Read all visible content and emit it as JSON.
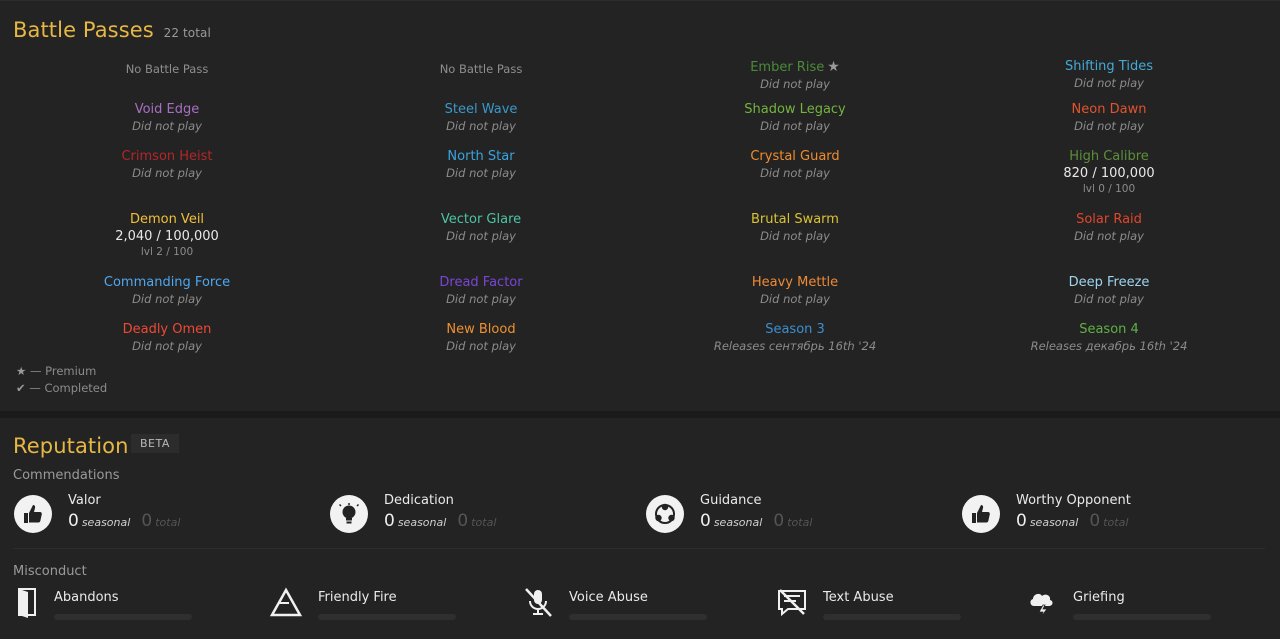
{
  "battle_passes": {
    "title": "Battle Passes",
    "count": "22 total",
    "items": [
      {
        "name": "No Battle Pass",
        "status": "",
        "color": "#8e8e8e",
        "none": true
      },
      {
        "name": "No Battle Pass",
        "status": "",
        "color": "#8e8e8e",
        "none": true
      },
      {
        "name": "Ember Rise",
        "status": "Did not play",
        "color": "#4c8a3a",
        "premium": true
      },
      {
        "name": "Shifting Tides",
        "status": "Did not play",
        "color": "#45a9d6"
      },
      {
        "name": "Void Edge",
        "status": "Did not play",
        "color": "#a86fc4"
      },
      {
        "name": "Steel Wave",
        "status": "Did not play",
        "color": "#3b98c9"
      },
      {
        "name": "Shadow Legacy",
        "status": "Did not play",
        "color": "#74b43d"
      },
      {
        "name": "Neon Dawn",
        "status": "Did not play",
        "color": "#e2532f"
      },
      {
        "name": "Crimson Heist",
        "status": "Did not play",
        "color": "#b3262a"
      },
      {
        "name": "North Star",
        "status": "Did not play",
        "color": "#3aa3e0"
      },
      {
        "name": "Crystal Guard",
        "status": "Did not play",
        "color": "#f08c2e"
      },
      {
        "name": "High Calibre",
        "status": "",
        "color": "#5d8f3a",
        "xp": "820 / 100,000",
        "level": "lvl 0 / 100"
      },
      {
        "name": "Demon Veil",
        "status": "",
        "color": "#f0c038",
        "xp": "2,040 / 100,000",
        "level": "lvl 2 / 100"
      },
      {
        "name": "Vector Glare",
        "status": "Did not play",
        "color": "#4cc4a4"
      },
      {
        "name": "Brutal Swarm",
        "status": "Did not play",
        "color": "#d9c234"
      },
      {
        "name": "Solar Raid",
        "status": "Did not play",
        "color": "#e0462c"
      },
      {
        "name": "Commanding Force",
        "status": "Did not play",
        "color": "#4fa7ef"
      },
      {
        "name": "Dread Factor",
        "status": "Did not play",
        "color": "#7a45d6"
      },
      {
        "name": "Heavy Mettle",
        "status": "Did not play",
        "color": "#ef8a36"
      },
      {
        "name": "Deep Freeze",
        "status": "Did not play",
        "color": "#9fd4ef"
      },
      {
        "name": "Deadly Omen",
        "status": "Did not play",
        "color": "#ec4a35"
      },
      {
        "name": "New Blood",
        "status": "Did not play",
        "color": "#ef9030"
      },
      {
        "name": "Season 3",
        "status": "Releases сентябрь 16th '24",
        "color": "#3b8fd0"
      },
      {
        "name": "Season 4",
        "status": "Releases декабрь 16th '24",
        "color": "#5fb145"
      }
    ],
    "legend": {
      "premium_symbol": "★",
      "premium_label": "— Premium",
      "completed_symbol": "✔",
      "completed_label": "— Completed"
    }
  },
  "reputation": {
    "title": "Reputation",
    "badge": "BETA",
    "commendations_label": "Commendations",
    "commendations": [
      {
        "title": "Valor",
        "seasonal": "0",
        "seasonal_label": "seasonal",
        "total": "0",
        "total_label": "total",
        "icon": "thumbs-up-icon"
      },
      {
        "title": "Dedication",
        "seasonal": "0",
        "seasonal_label": "seasonal",
        "total": "0",
        "total_label": "total",
        "icon": "lightbulb-icon"
      },
      {
        "title": "Guidance",
        "seasonal": "0",
        "seasonal_label": "seasonal",
        "total": "0",
        "total_label": "total",
        "icon": "team-icon"
      },
      {
        "title": "Worthy Opponent",
        "seasonal": "0",
        "seasonal_label": "seasonal",
        "total": "0",
        "total_label": "total",
        "icon": "thumbs-up-icon"
      }
    ],
    "misconduct_label": "Misconduct",
    "misconduct": [
      {
        "title": "Abandons",
        "icon": "door-icon",
        "level": 0
      },
      {
        "title": "Friendly Fire",
        "icon": "triangle-icon",
        "level": 0
      },
      {
        "title": "Voice Abuse",
        "icon": "muted-mic-icon",
        "level": 0
      },
      {
        "title": "Text Abuse",
        "icon": "crossed-chat-icon",
        "level": 0
      },
      {
        "title": "Griefing",
        "icon": "storm-cloud-icon",
        "level": 0
      }
    ]
  }
}
